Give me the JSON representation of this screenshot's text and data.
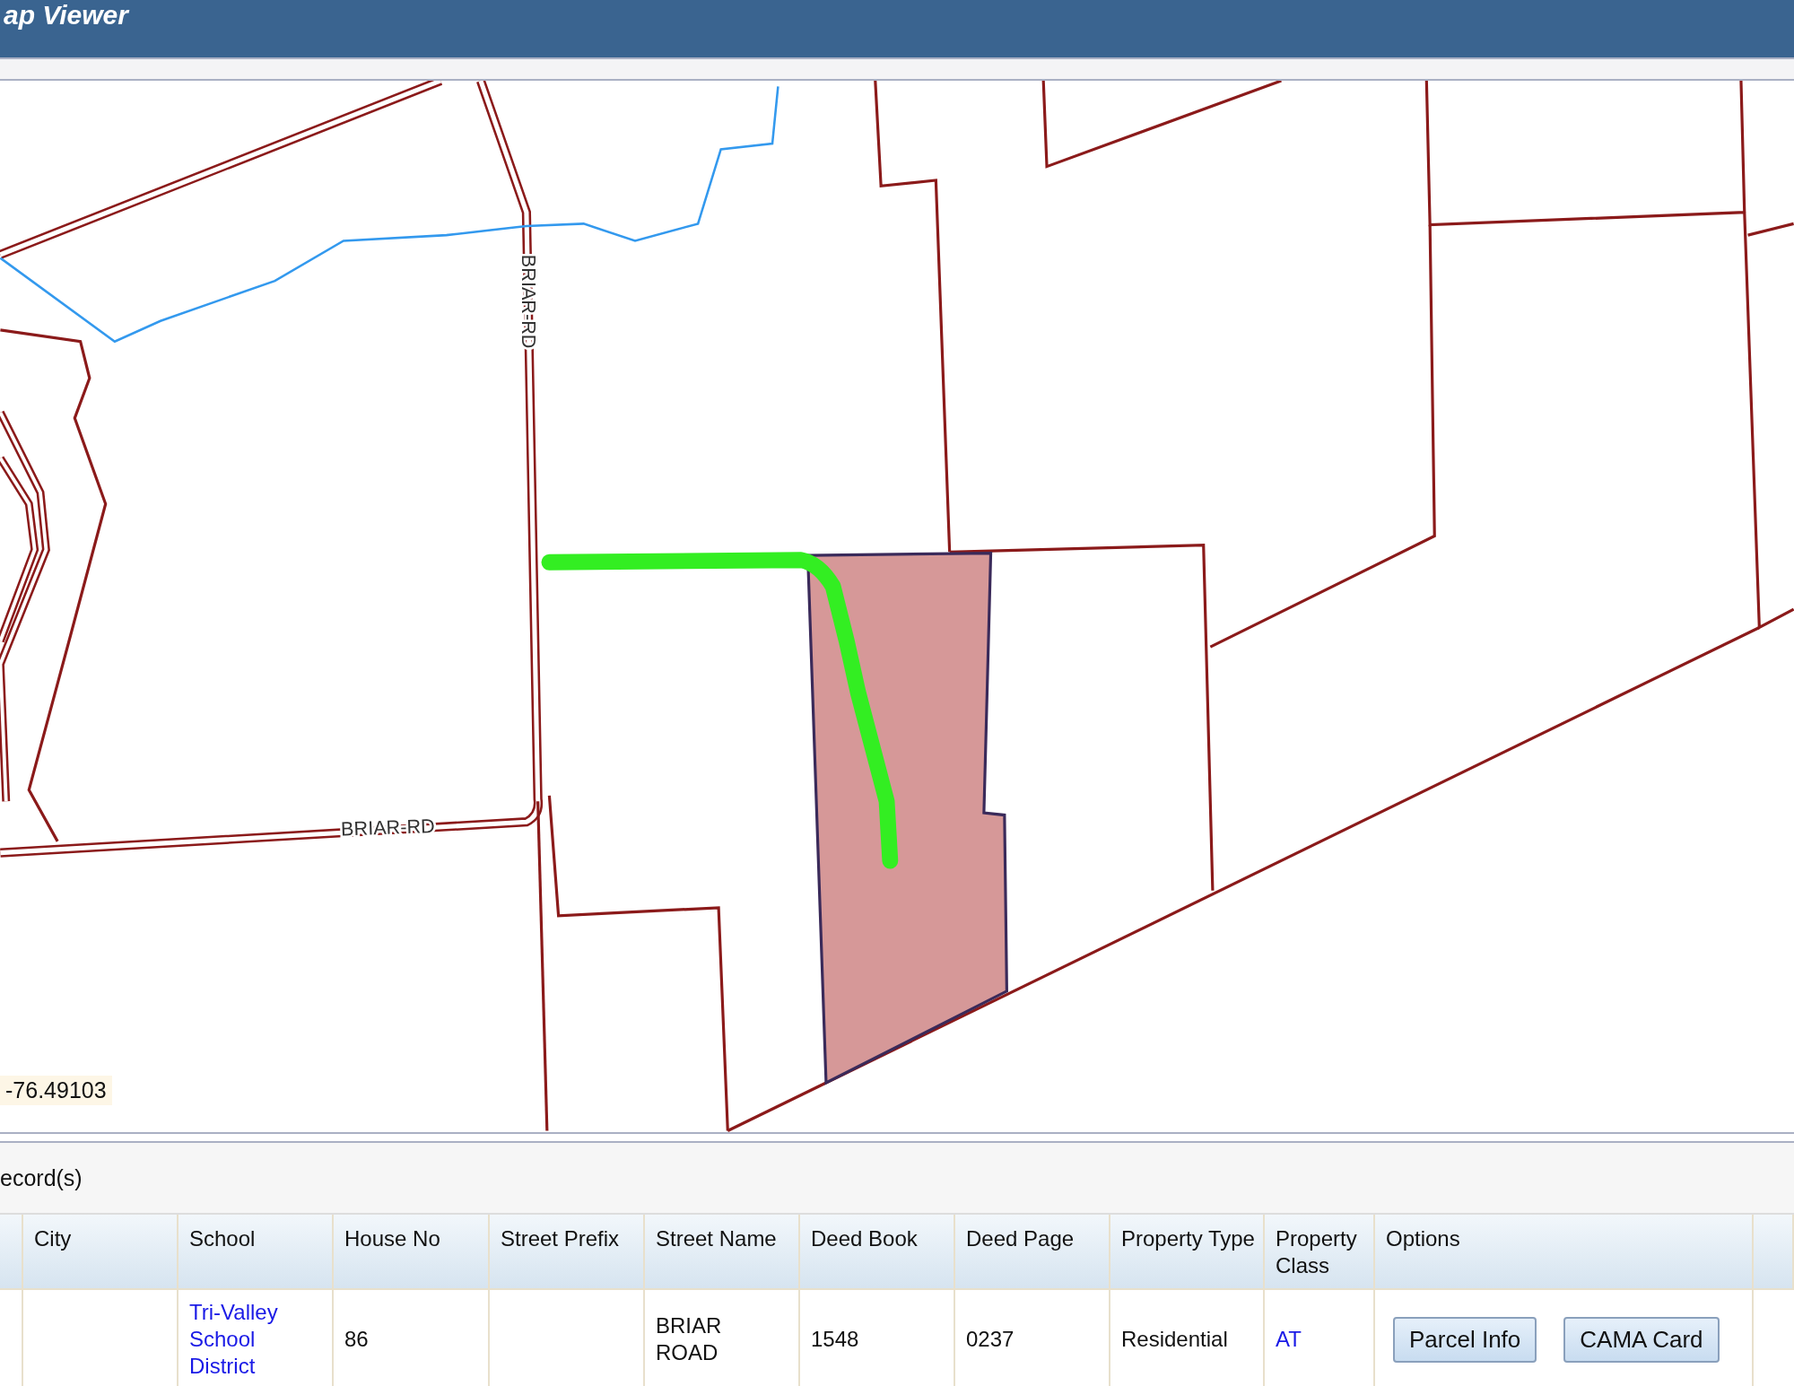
{
  "header": {
    "title": "ap Viewer"
  },
  "map": {
    "road_labels": [
      "BRIAR-RD",
      "BRIAR-RD"
    ],
    "coordinate": "-76.49103"
  },
  "results": {
    "count_label": "ecord(s)",
    "columns": [
      "",
      "City",
      "School",
      "House No",
      "Street Prefix",
      "Street Name",
      "Deed Book",
      "Deed Page",
      "Property Type",
      "Property Class",
      "Options"
    ],
    "rows": [
      {
        "cells": [
          {
            "text": ""
          },
          {
            "text": ""
          },
          {
            "text": "Tri-Valley School District",
            "link": true
          },
          {
            "text": "86",
            "link": false
          },
          {
            "text": ""
          },
          {
            "text": "BRIAR ROAD",
            "link": false
          },
          {
            "text": "1548",
            "link": false
          },
          {
            "text": "0237",
            "link": false
          },
          {
            "text": "Residential",
            "link": false
          },
          {
            "text": "AT",
            "link": true
          }
        ],
        "buttons": [
          "Parcel Info",
          "CAMA Card"
        ]
      }
    ]
  }
}
